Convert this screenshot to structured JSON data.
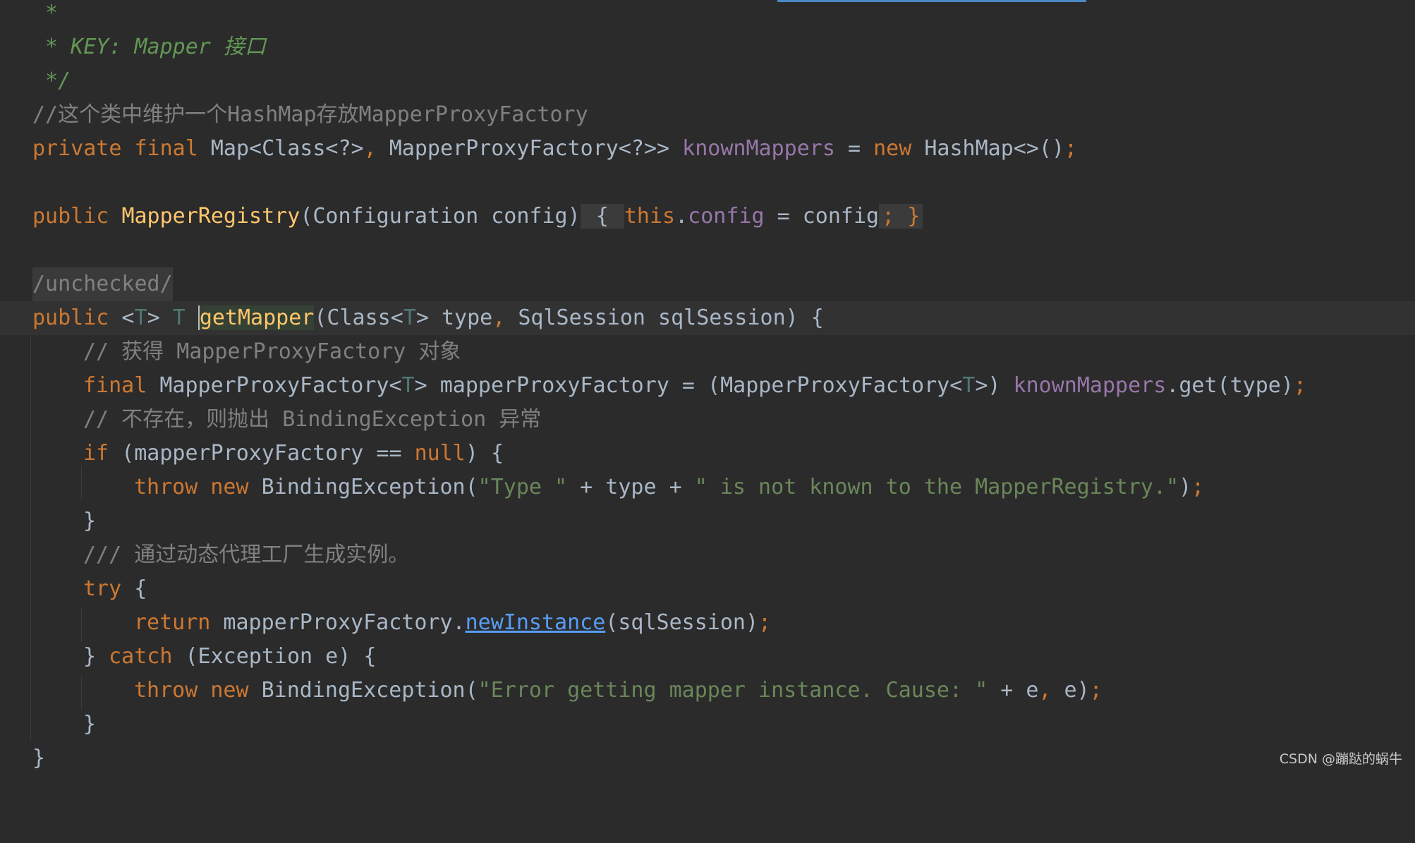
{
  "editor": {
    "theme": {
      "background": "#2b2b2b",
      "keyword": "#cc7832",
      "string": "#6a8759",
      "field": "#9876aa",
      "function": "#ffc66d",
      "comment": "#808080",
      "doc": "#629755",
      "link": "#589df6"
    },
    "lines": {
      "l1": {
        "a": " *"
      },
      "l2": {
        "a": " * KEY: Mapper 接口"
      },
      "l3": {
        "a": " */"
      },
      "l4": {
        "a": "//这个类中维护一个HashMap存放MapperProxyFactory"
      },
      "l5": {
        "a": "private",
        "b": " ",
        "c": "final",
        "d": " Map<Class<?>",
        "e": ",",
        "f": " MapperProxyFactory<?>> ",
        "g": "knownMappers",
        "h": " = ",
        "i": "new",
        "j": " HashMap<>()",
        "k": ";"
      },
      "l7": {
        "a": "public",
        "b": " ",
        "c": "MapperRegistry",
        "d": "(Configuration config)",
        "e": " { ",
        "f": "this",
        "g": ".",
        "h": "config",
        "i": " = config",
        "j": "; }"
      },
      "l9": {
        "a": "/unchecked/"
      },
      "l10": {
        "a": "public",
        "b": " <",
        "c": "T",
        "d": "> ",
        "e": "T",
        "f": " ",
        "g": "g",
        "h": "etMapper",
        "i": "(Class<",
        "j": "T",
        "k": "> type",
        "l": ",",
        "m": " SqlSession sqlSession) {"
      },
      "l11": {
        "a": "// 获得 MapperProxyFactory 对象"
      },
      "l12": {
        "a": "final",
        "b": " MapperProxyFactory<",
        "c": "T",
        "d": "> mapperProxyFactory = (MapperProxyFactory<",
        "e": "T",
        "f": ">) ",
        "g": "knownMappers",
        "h": ".get(type)",
        "i": ";"
      },
      "l13": {
        "a": "// 不存在，则抛出 BindingException 异常"
      },
      "l14": {
        "a": "if",
        "b": " (mapperProxyFactory == ",
        "c": "null",
        "d": ") {"
      },
      "l15": {
        "a": "throw",
        "b": " ",
        "c": "new",
        "d": " BindingException(",
        "e": "\"Type \"",
        "f": " + type + ",
        "g": "\" is not known to the MapperRegistry.\"",
        "h": ")",
        "i": ";"
      },
      "l16": {
        "a": "}"
      },
      "l17": {
        "a": "/// 通过动态代理工厂生成实例。"
      },
      "l18": {
        "a": "try",
        "b": " {"
      },
      "l19": {
        "a": "return",
        "b": " mapperProxyFactory.",
        "c": "newInstance",
        "d": "(sqlSession)",
        "e": ";"
      },
      "l20": {
        "a": "} ",
        "b": "catch",
        "c": " (Exception e) {"
      },
      "l21": {
        "a": "throw",
        "b": " ",
        "c": "new",
        "d": " BindingException(",
        "e": "\"Error getting mapper instance. Cause: \"",
        "f": " + e",
        "g": ",",
        "h": " e)",
        "i": ";"
      },
      "l22": {
        "a": "}"
      },
      "l23": {
        "a": "}"
      }
    }
  },
  "watermark": "CSDN @蹦跶的蜗牛"
}
